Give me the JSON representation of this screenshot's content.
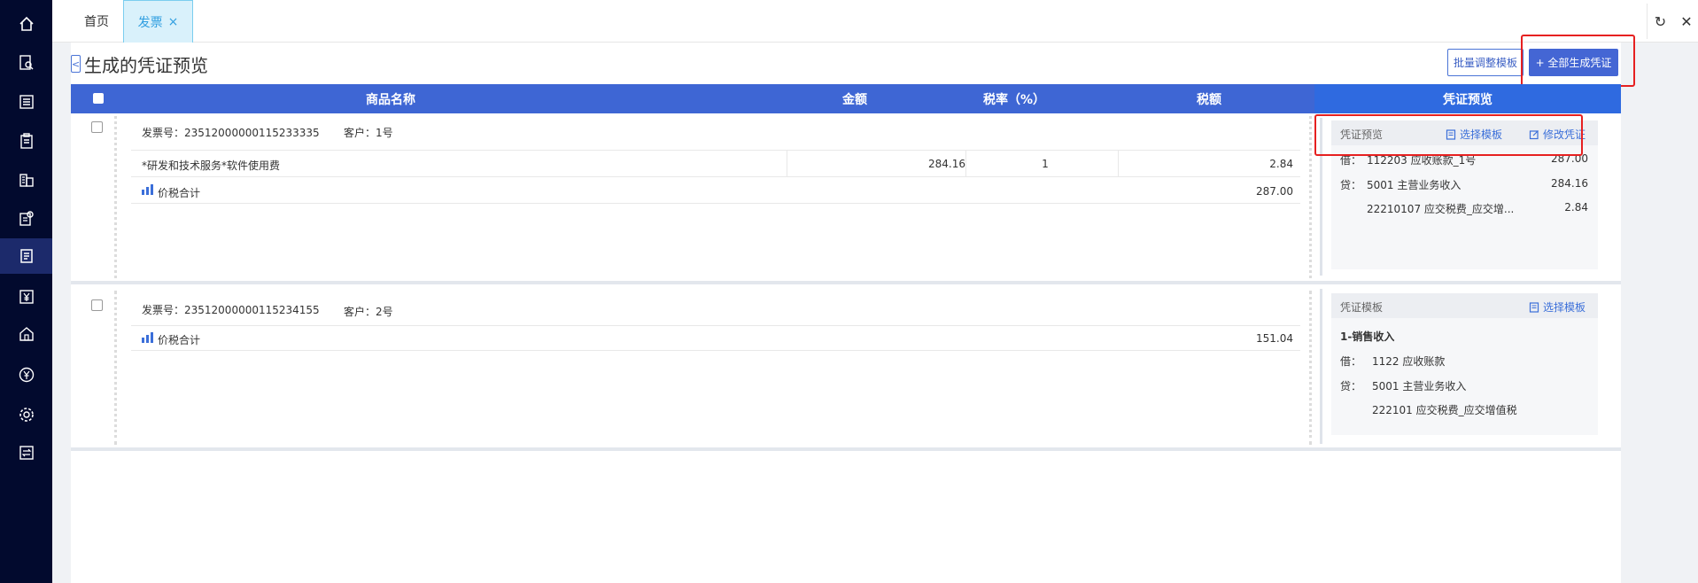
{
  "topbar": {
    "tab_home": "首页",
    "tab_active": "发票",
    "tab_close": "×",
    "refresh": "↻",
    "close": "✕"
  },
  "sidebar": {
    "icons": [
      "home-icon",
      "search-doc-icon",
      "list-icon",
      "clipboard-icon",
      "building-icon",
      "doc-gear-icon",
      "invoice-icon",
      "yen-doc-icon",
      "house-icon",
      "yen-circle-icon",
      "gear-icon",
      "transfer-icon"
    ]
  },
  "page": {
    "title": "生成的凭证预览",
    "back": "<",
    "btn_batch": "批量调整模板",
    "btn_generate": "+ 全部生成凭证"
  },
  "table": {
    "headers": {
      "name": "商品名称",
      "amount": "金额",
      "rate": "税率（%）",
      "tax": "税额",
      "preview": "凭证预览"
    }
  },
  "invoices": [
    {
      "invoice_no": "发票号：23512000000115233335",
      "customer": "客户：1号",
      "item": {
        "name": "*研发和技术服务*软件使用费",
        "amount": "284.16",
        "rate": "1",
        "tax": "2.84"
      },
      "total_label": "价税合计",
      "total": "287.00",
      "voucher": {
        "head": "凭证预览",
        "link1": "选择模板",
        "link2": "修改凭证",
        "lines": [
          {
            "dc": "借：",
            "account": "112203 应收账款_1号",
            "amount": "287.00"
          },
          {
            "dc": "贷：",
            "account": "5001 主营业务收入",
            "amount": "284.16"
          },
          {
            "dc": "",
            "account": "22210107 应交税费_应交增...",
            "amount": "2.84"
          }
        ]
      }
    },
    {
      "invoice_no": "发票号：23512000000115234155",
      "customer": "客户：2号",
      "total_label": "价税合计",
      "total": "151.04",
      "voucher": {
        "head": "凭证模板",
        "link1": "选择模板",
        "template_name": "1-销售收入",
        "lines": [
          {
            "dc": "借：",
            "account": "1122 应收账款"
          },
          {
            "dc": "贷：",
            "account": "5001 主营业务收入"
          },
          {
            "dc": "",
            "account": "222101 应交税费_应交增值税"
          }
        ]
      }
    }
  ]
}
